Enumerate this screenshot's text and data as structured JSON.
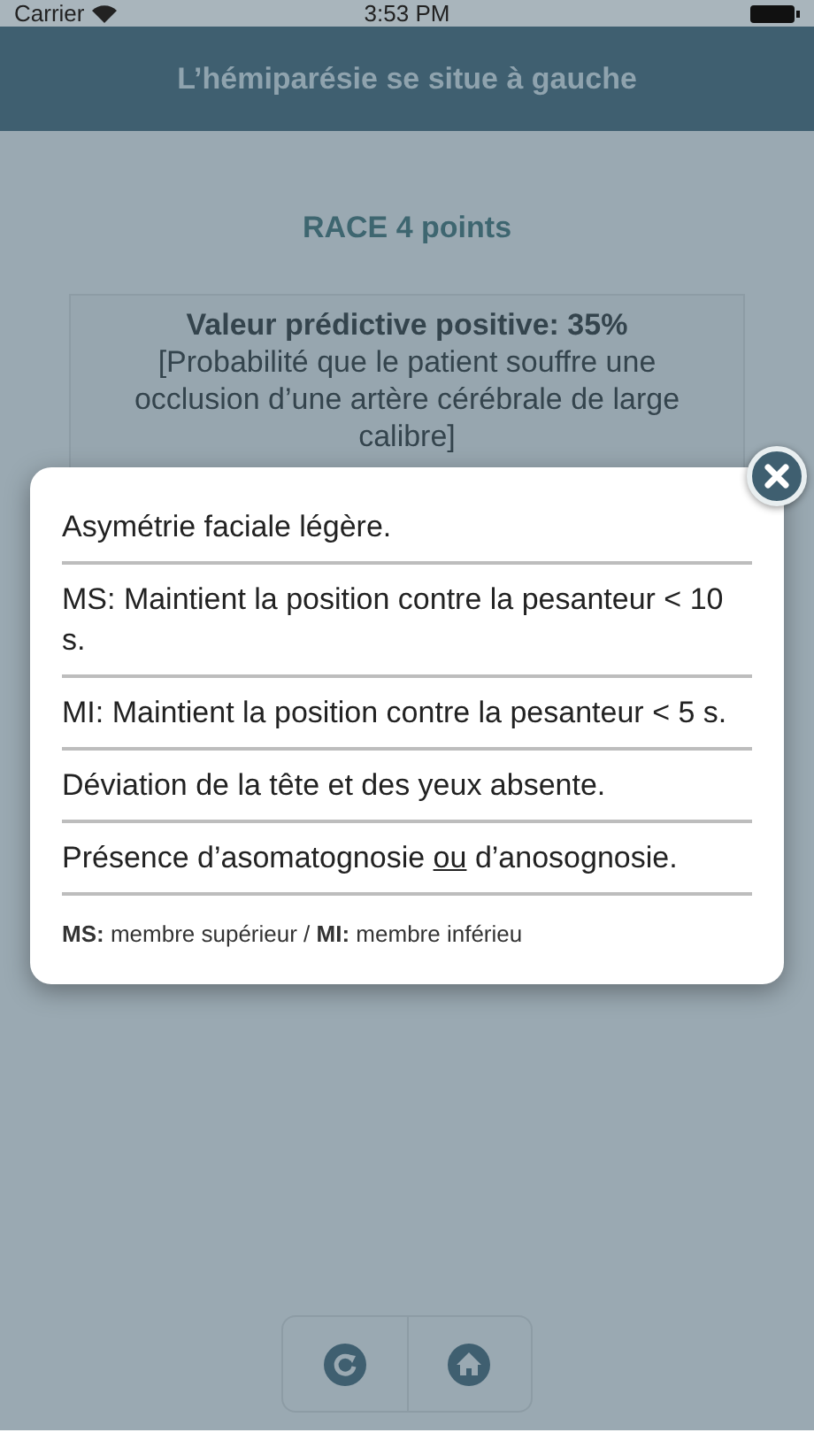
{
  "status_bar": {
    "carrier": "Carrier",
    "time": "3:53 PM"
  },
  "header": {
    "title": "L’hémiparésie se situe à gauche"
  },
  "score": "RACE 4 points",
  "result": {
    "title": "Valeur prédictive positive: 35%",
    "detail": "[Probabilité que le patient souffre une occlusion d’une artère cérébrale de large calibre]"
  },
  "popup": {
    "items": [
      {
        "parts": [
          {
            "text": "Asymétrie faciale légère.",
            "underline": false
          }
        ]
      },
      {
        "parts": [
          {
            "text": "MS: Maintient la position contre la pesanteur < 10 s.",
            "underline": false
          }
        ]
      },
      {
        "parts": [
          {
            "text": "MI: Maintient la position contre la pesanteur < 5 s.",
            "underline": false
          }
        ]
      },
      {
        "parts": [
          {
            "text": "Déviation de la tête et des yeux absente.",
            "underline": false
          }
        ]
      },
      {
        "parts": [
          {
            "text": "Présence d’asomatognosie ",
            "underline": false
          },
          {
            "text": "ou",
            "underline": true
          },
          {
            "text": " d’anosognosie.",
            "underline": false
          }
        ]
      }
    ],
    "footnote": "**MS:** membre supérieur / **MI:** membre inférieu"
  }
}
